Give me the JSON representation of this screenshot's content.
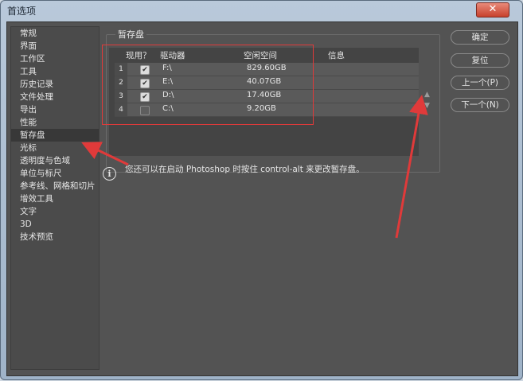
{
  "window": {
    "title": "首选项",
    "close_glyph": "✕"
  },
  "sidebar": {
    "items": [
      {
        "label": "常规"
      },
      {
        "label": "界面"
      },
      {
        "label": "工作区"
      },
      {
        "label": "工具"
      },
      {
        "label": "历史记录"
      },
      {
        "label": "文件处理"
      },
      {
        "label": "导出"
      },
      {
        "label": "性能"
      },
      {
        "label": "暂存盘"
      },
      {
        "label": "光标"
      },
      {
        "label": "透明度与色域"
      },
      {
        "label": "单位与标尺"
      },
      {
        "label": "参考线、网格和切片"
      },
      {
        "label": "增效工具"
      },
      {
        "label": "文字"
      },
      {
        "label": "3D"
      },
      {
        "label": "技术预览"
      }
    ],
    "selected_index": 8
  },
  "scratch": {
    "group_label": "暂存盘",
    "columns": {
      "active": "现用？",
      "drive": "驱动器",
      "free": "空闲空间",
      "info": "信息"
    },
    "rows": [
      {
        "num": "1",
        "checked": true,
        "drive": "F:\\",
        "free": "829.60GB"
      },
      {
        "num": "2",
        "checked": true,
        "drive": "E:\\",
        "free": "40.07GB"
      },
      {
        "num": "3",
        "checked": true,
        "drive": "D:\\",
        "free": "17.40GB"
      },
      {
        "num": "4",
        "checked": false,
        "drive": "C:\\",
        "free": "9.20GB"
      }
    ],
    "check_glyph": "✔",
    "up_glyph": "▲",
    "down_glyph": "▼"
  },
  "info": {
    "icon": "i",
    "text": "您还可以在启动 Photoshop 时按住 control-alt 来更改暂存盘。"
  },
  "buttons": {
    "ok": "确定",
    "reset": "复位",
    "prev": "上一个(P)",
    "next": "下一个(N)"
  },
  "colors": {
    "accent_annotation": "#e03a3a",
    "panel": "#535353"
  }
}
